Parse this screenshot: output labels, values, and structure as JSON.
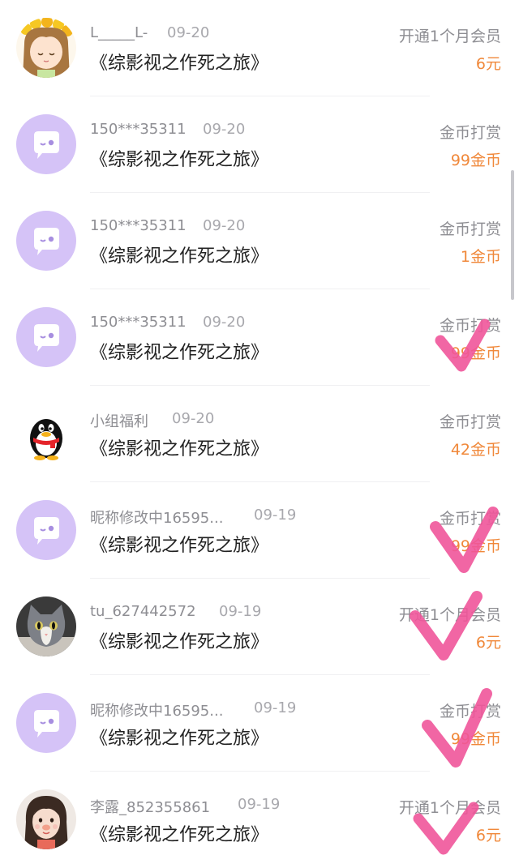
{
  "records": [
    {
      "name": "L_____L-",
      "date": "09-20",
      "book": "《综影视之作死之旅》",
      "type": "开通1个月会员",
      "amount": "6元",
      "avatar": "cartoon-girl-avatar"
    },
    {
      "name": "150***35311",
      "date": "09-20",
      "book": "《综影视之作死之旅》",
      "type": "金币打赏",
      "amount": "99金币",
      "avatar": "default-chat-avatar"
    },
    {
      "name": "150***35311",
      "date": "09-20",
      "book": "《综影视之作死之旅》",
      "type": "金币打赏",
      "amount": "1金币",
      "avatar": "default-chat-avatar"
    },
    {
      "name": "150***35311",
      "date": "09-20",
      "book": "《综影视之作死之旅》",
      "type": "金币打赏",
      "amount": "99金币",
      "avatar": "default-chat-avatar"
    },
    {
      "name": "小组福利",
      "date": "09-20",
      "book": "《综影视之作死之旅》",
      "type": "金币打赏",
      "amount": "42金币",
      "avatar": "penguin-avatar"
    },
    {
      "name": "昵称修改中16595...",
      "date": "09-19",
      "book": "《综影视之作死之旅》",
      "type": "金币打赏",
      "amount": "99金币",
      "avatar": "default-chat-avatar"
    },
    {
      "name": "tu_627442572",
      "date": "09-19",
      "book": "《综影视之作死之旅》",
      "type": "开通1个月会员",
      "amount": "6元",
      "avatar": "cat-photo-avatar"
    },
    {
      "name": "昵称修改中16595...",
      "date": "09-19",
      "book": "《综影视之作死之旅》",
      "type": "金币打赏",
      "amount": "99金币",
      "avatar": "default-chat-avatar"
    },
    {
      "name": "李露_852355861",
      "date": "09-19",
      "book": "《综影视之作死之旅》",
      "type": "开通1个月会员",
      "amount": "6元",
      "avatar": "girl-photo-avatar"
    }
  ],
  "colors": {
    "amount": "#f0883a",
    "check_mark": "#f0559a",
    "default_avatar": "#d5c3f7"
  }
}
